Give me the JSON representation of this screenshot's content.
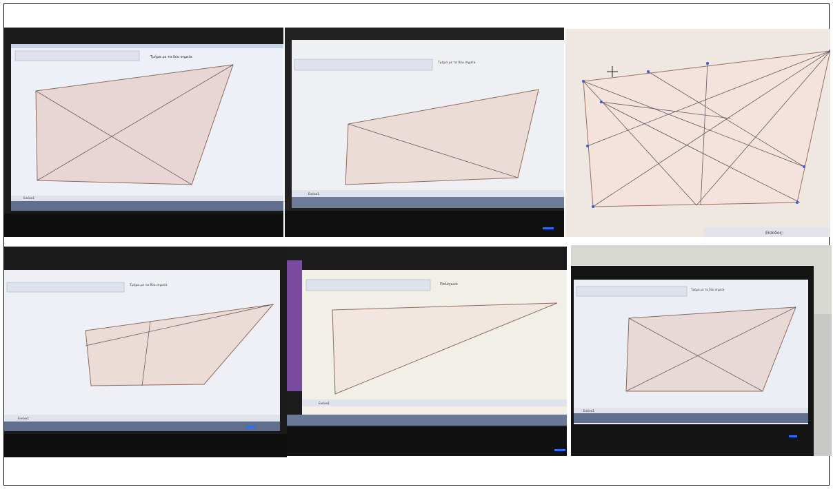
{
  "photos": [
    {
      "id": "photo-1",
      "toolbar_text": "Τμήμα με τα δύο σημεία",
      "taskbar_label": "Εικόνα1"
    },
    {
      "id": "photo-2",
      "toolbar_text": "Τμήμα με τα δύο σημεία",
      "taskbar_label": "Εικόνα1"
    },
    {
      "id": "photo-3",
      "status_text": "Είσοδος:"
    },
    {
      "id": "photo-4",
      "toolbar_text": "Τμήμα με τα δύο σημεία",
      "taskbar_label": "Εικόνα1"
    },
    {
      "id": "photo-5",
      "toolbar_text": "Πολύγωνο",
      "taskbar_label": "Εικόνα1"
    },
    {
      "id": "photo-6",
      "toolbar_text": "Τμήμα με τα δύο σημεία",
      "taskbar_label": "Εικόνα1"
    }
  ],
  "colors": {
    "screen": "#e9ecf6",
    "polygon_fill": "#e6d2d2",
    "polygon_stroke": "#9b6e60",
    "monitor": "#141414",
    "taskbar": "#5f6f8d"
  }
}
